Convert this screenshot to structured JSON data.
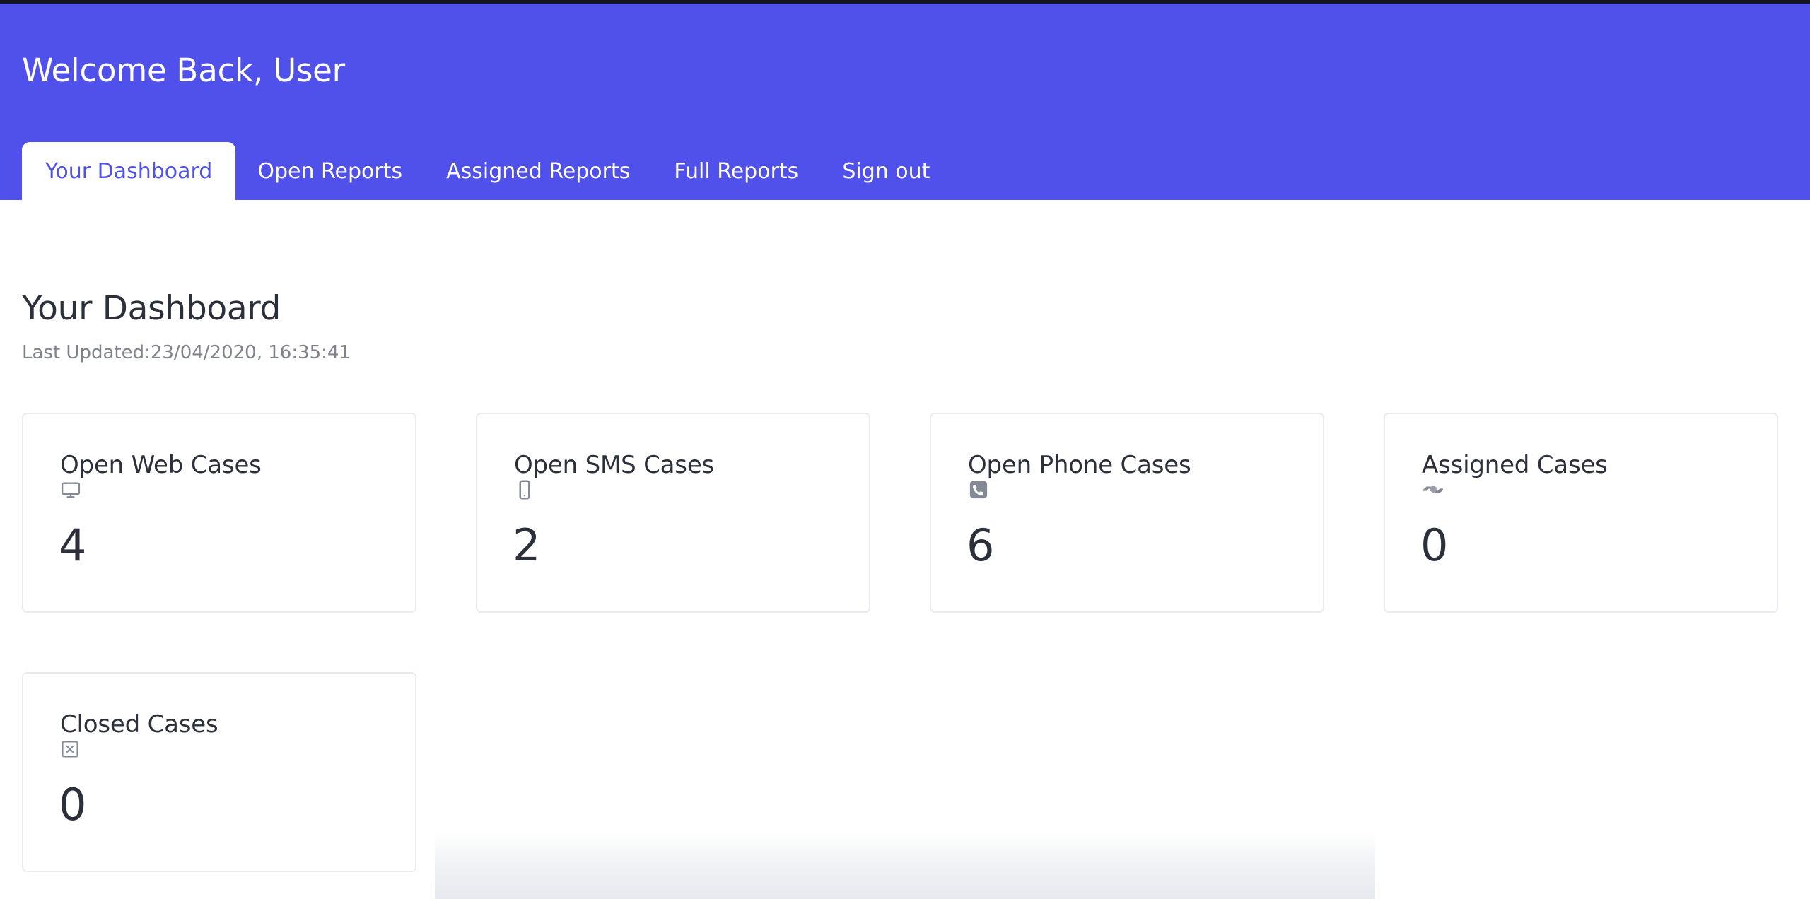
{
  "header": {
    "welcome_text": "Welcome Back, User",
    "brand_color": "#5050eb",
    "nav": [
      {
        "label": "Your Dashboard",
        "active": true
      },
      {
        "label": "Open Reports",
        "active": false
      },
      {
        "label": "Assigned Reports",
        "active": false
      },
      {
        "label": "Full Reports",
        "active": false
      },
      {
        "label": "Sign out",
        "active": false
      }
    ]
  },
  "main": {
    "page_title": "Your Dashboard",
    "last_updated": "Last Updated:23/04/2020, 16:35:41",
    "cards": [
      {
        "title": "Open Web Cases",
        "value": "4",
        "icon": "desktop-monitor-icon"
      },
      {
        "title": "Open SMS Cases",
        "value": "2",
        "icon": "mobile-phone-icon"
      },
      {
        "title": "Open Phone Cases",
        "value": "6",
        "icon": "telephone-receiver-icon"
      },
      {
        "title": "Assigned Cases",
        "value": "0",
        "icon": "handshake-icon"
      },
      {
        "title": "Closed Cases",
        "value": "0",
        "icon": "cross-mark-box-icon"
      }
    ]
  },
  "colors": {
    "accent": "#5050eb",
    "accent_text": "#4f51ec",
    "text_primary": "#2b303a",
    "text_muted": "#7f838c",
    "card_border": "#e9ebf0",
    "top_strip": "#16171c",
    "icon_gray": "#838a96"
  }
}
